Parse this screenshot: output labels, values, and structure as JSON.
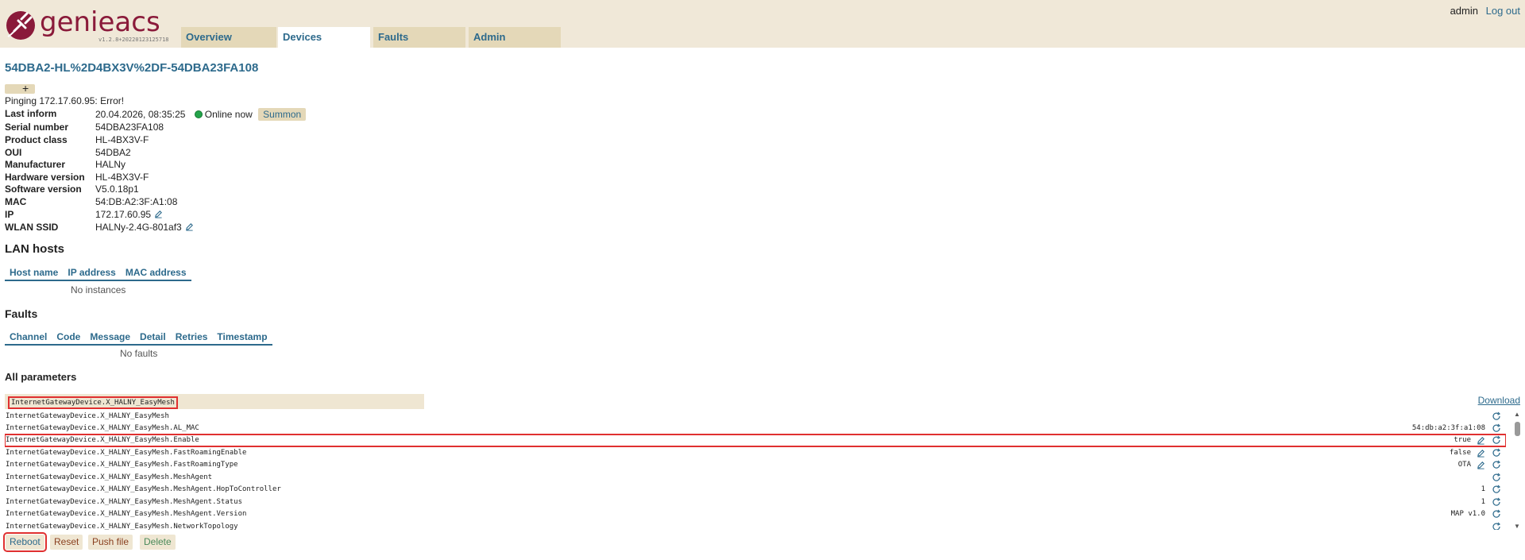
{
  "header": {
    "logo_text": "genieacs",
    "version": "v1.2.8+20220123125718",
    "tabs": [
      {
        "label": "Overview"
      },
      {
        "label": "Devices"
      },
      {
        "label": "Faults"
      },
      {
        "label": "Admin"
      }
    ],
    "active_tab": "Devices",
    "user": "admin",
    "logout": "Log out"
  },
  "device": {
    "title": "54DBA2-HL%2D4BX3V%2DF-54DBA23FA108",
    "tag_add": "+",
    "ping_status": "Pinging 172.17.60.95: Error!",
    "summary": [
      {
        "label": "Last inform",
        "value": "20.04.2026, 08:35:25"
      },
      {
        "label": "Serial number",
        "value": "54DBA23FA108"
      },
      {
        "label": "Product class",
        "value": "HL-4BX3V-F"
      },
      {
        "label": "OUI",
        "value": "54DBA2"
      },
      {
        "label": "Manufacturer",
        "value": "HALNy"
      },
      {
        "label": "Hardware version",
        "value": "HL-4BX3V-F"
      },
      {
        "label": "Software version",
        "value": "V5.0.18p1"
      },
      {
        "label": "MAC",
        "value": "54:DB:A2:3F:A1:08"
      },
      {
        "label": "IP",
        "value": "172.17.60.95"
      },
      {
        "label": "WLAN SSID",
        "value": "HALNy-2.4G-801af3"
      }
    ],
    "online_status": "Online now",
    "summon_label": "Summon"
  },
  "lan_hosts": {
    "heading": "LAN hosts",
    "columns": [
      "Host name",
      "IP address",
      "MAC address"
    ],
    "empty": "No instances"
  },
  "faults": {
    "heading": "Faults",
    "columns": [
      "Channel",
      "Code",
      "Message",
      "Detail",
      "Retries",
      "Timestamp"
    ],
    "empty": "No faults"
  },
  "parameters": {
    "heading": "All parameters",
    "search_value": "InternetGatewayDevice.X_HALNY_EasyMesh",
    "download_label": "Download",
    "rows": [
      {
        "name": "InternetGatewayDevice.X_HALNY_EasyMesh",
        "value": ""
      },
      {
        "name": "InternetGatewayDevice.X_HALNY_EasyMesh.AL_MAC",
        "value": "54:db:a2:3f:a1:08"
      },
      {
        "name": "InternetGatewayDevice.X_HALNY_EasyMesh.Enable",
        "value": "true"
      },
      {
        "name": "InternetGatewayDevice.X_HALNY_EasyMesh.FastRoamingEnable",
        "value": "false"
      },
      {
        "name": "InternetGatewayDevice.X_HALNY_EasyMesh.FastRoamingType",
        "value": "OTA"
      },
      {
        "name": "InternetGatewayDevice.X_HALNY_EasyMesh.MeshAgent",
        "value": ""
      },
      {
        "name": "InternetGatewayDevice.X_HALNY_EasyMesh.MeshAgent.HopToController",
        "value": "1"
      },
      {
        "name": "InternetGatewayDevice.X_HALNY_EasyMesh.MeshAgent.Status",
        "value": "1"
      },
      {
        "name": "InternetGatewayDevice.X_HALNY_EasyMesh.MeshAgent.Version",
        "value": "MAP v1.0"
      },
      {
        "name": "InternetGatewayDevice.X_HALNY_EasyMesh.NetworkTopology",
        "value": ""
      }
    ]
  },
  "actions": {
    "reboot": "Reboot",
    "reset": "Reset",
    "push_file": "Push file",
    "delete": "Delete"
  }
}
